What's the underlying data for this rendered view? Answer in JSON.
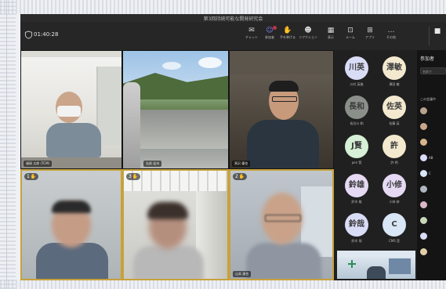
{
  "meeting": {
    "window_title": "第3回持続可能な開発研究会",
    "timer": "01:40:28"
  },
  "toolbar": {
    "items": [
      {
        "label": "チャット",
        "icon": "chat-icon",
        "glyph": "✉",
        "active": false,
        "badge": false
      },
      {
        "label": "参加者",
        "icon": "people-icon",
        "glyph": "☺",
        "active": true,
        "badge": true
      },
      {
        "label": "手を挙げる",
        "icon": "raise-hand-icon",
        "glyph": "✋",
        "active": false,
        "badge": false
      },
      {
        "label": "リアクション",
        "icon": "react-icon",
        "glyph": "☻",
        "active": false,
        "badge": false
      },
      {
        "label": "表示",
        "icon": "view-icon",
        "glyph": "▦",
        "active": false,
        "badge": false
      },
      {
        "label": "ルーム",
        "icon": "rooms-icon",
        "glyph": "⊡",
        "active": false,
        "badge": false
      },
      {
        "label": "アプリ",
        "icon": "apps-icon",
        "glyph": "⊞",
        "active": false,
        "badge": false
      },
      {
        "label": "その他",
        "icon": "more-icon",
        "glyph": "…",
        "active": false,
        "badge": false
      }
    ],
    "camera_icon": "camera-icon",
    "camera_glyph": "■"
  },
  "tiles": [
    {
      "name": "福岡 太郎 (TCM)",
      "hand": ""
    },
    {
      "name": "弘前 岩市",
      "hand": ""
    },
    {
      "name": "黒沢 優也",
      "hand": ""
    },
    {
      "name": "",
      "hand": "1"
    },
    {
      "name": "",
      "hand": "3"
    },
    {
      "name": "山本 達也",
      "hand": "2"
    }
  ],
  "roster": [
    {
      "initials": "川英",
      "name": "川村 英雄",
      "color": "#d9dcf5"
    },
    {
      "initials": "澤敏",
      "name": "澤田 敏",
      "color": "#f3e9cf"
    },
    {
      "initials": "長和",
      "name": "長谷川 和",
      "color": "#8a8f8a"
    },
    {
      "initials": "佐英",
      "name": "佐藤 英",
      "color": "#f3e9cf"
    },
    {
      "initials": "J賢",
      "name": "pen 賢",
      "color": "#d6efd6"
    },
    {
      "initials": "許",
      "name": "許 明",
      "color": "#f3e9cf"
    },
    {
      "initials": "鈴雄",
      "name": "鈴木 雄",
      "color": "#e5d9f3"
    },
    {
      "initials": "小修",
      "name": "小林 修",
      "color": "#e5d9f3"
    },
    {
      "initials": "鈴哉",
      "name": "鈴木 哉",
      "color": "#d9dcf5"
    },
    {
      "initials": "C",
      "name": "CMS 室",
      "color": "#d9e6f5"
    }
  ],
  "panel": {
    "title": "参加者",
    "search_placeholder": "名前で",
    "section": "この会議中",
    "people": [
      {
        "initials": "",
        "color": "#b8a28c"
      },
      {
        "initials": "",
        "color": "#caa58a"
      },
      {
        "initials": "",
        "color": "#d7b48c"
      },
      {
        "initials": "AB",
        "color": "#d9dcf5"
      },
      {
        "initials": "C",
        "color": "#d9e6f5"
      },
      {
        "initials": "",
        "color": "#b0b6c0"
      },
      {
        "initials": "",
        "color": "#d9b8c8"
      },
      {
        "initials": "",
        "color": "#c8d6b8"
      },
      {
        "initials": "",
        "color": "#d9dcf5"
      },
      {
        "initials": "",
        "color": "#e2cfa8"
      }
    ]
  }
}
